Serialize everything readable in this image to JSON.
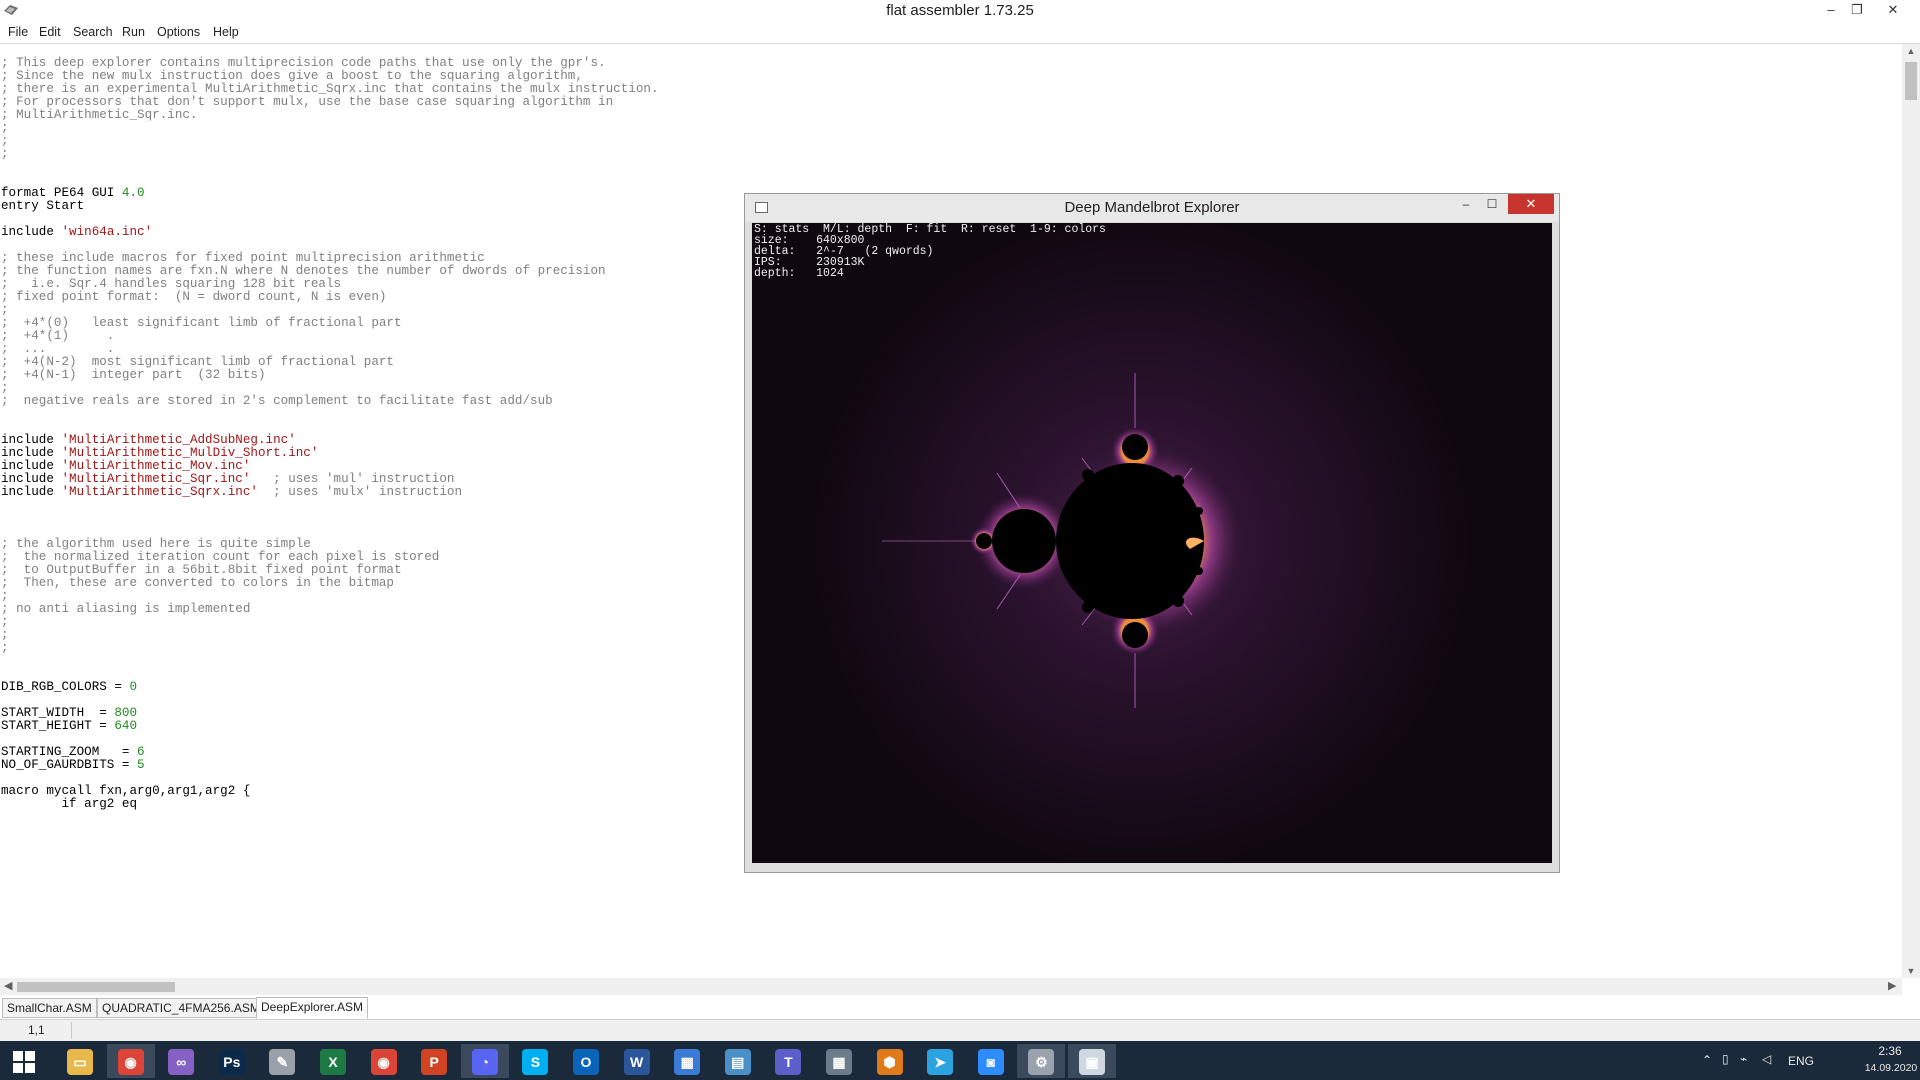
{
  "window": {
    "title": "flat assembler 1.73.25",
    "minimize_glyph": "–",
    "restore_glyph": "❐",
    "close_glyph": "✕"
  },
  "menu": [
    "File",
    "Edit",
    "Search",
    "Run",
    "Options",
    "Help"
  ],
  "code_lines": [
    [
      [
        "c",
        "; This deep explorer contains multiprecision code paths that use only the gpr's."
      ]
    ],
    [
      [
        "c",
        "; Since the new mulx instruction does give a boost to the squaring algorithm,"
      ]
    ],
    [
      [
        "c",
        "; there is an experimental MultiArithmetic_Sqrx.inc that contains the mulx instruction."
      ]
    ],
    [
      [
        "c",
        "; For processors that don't support mulx, use the base case squaring algorithm in"
      ]
    ],
    [
      [
        "c",
        "; MultiArithmetic_Sqr.inc."
      ]
    ],
    [
      [
        "c",
        ";"
      ]
    ],
    [
      [
        "c",
        ";"
      ]
    ],
    [
      [
        "c",
        ";"
      ]
    ],
    [],
    [],
    [
      [
        "p",
        "format PE64 GUI "
      ],
      [
        "n",
        "4.0"
      ]
    ],
    [
      [
        "p",
        "entry Start"
      ]
    ],
    [],
    [
      [
        "p",
        "include "
      ],
      [
        "s",
        "'win64a.inc'"
      ]
    ],
    [],
    [
      [
        "c",
        "; these include macros for fixed point multiprecision arithmetic"
      ]
    ],
    [
      [
        "c",
        "; the function names are fxn.N where N denotes the number of dwords of precision"
      ]
    ],
    [
      [
        "c",
        ";   i.e. Sqr.4 handles squaring 128 bit reals"
      ]
    ],
    [
      [
        "c",
        "; fixed point format:  (N = dword count, N is even)"
      ]
    ],
    [
      [
        "c",
        ";"
      ]
    ],
    [
      [
        "c",
        ";  +4*(0)   least significant limb of fractional part"
      ]
    ],
    [
      [
        "c",
        ";  +4*(1)     ."
      ]
    ],
    [
      [
        "c",
        ";  ...        ."
      ]
    ],
    [
      [
        "c",
        ";  +4(N-2)  most significant limb of fractional part"
      ]
    ],
    [
      [
        "c",
        ";  +4(N-1)  integer part  (32 bits)"
      ]
    ],
    [
      [
        "c",
        ";"
      ]
    ],
    [
      [
        "c",
        ";  negative reals are stored in 2's complement to facilitate fast add/sub"
      ]
    ],
    [],
    [],
    [
      [
        "p",
        "include "
      ],
      [
        "s",
        "'MultiArithmetic_AddSubNeg.inc'"
      ]
    ],
    [
      [
        "p",
        "include "
      ],
      [
        "s",
        "'MultiArithmetic_MulDiv_Short.inc'"
      ]
    ],
    [
      [
        "p",
        "include "
      ],
      [
        "s",
        "'MultiArithmetic_Mov.inc'"
      ]
    ],
    [
      [
        "p",
        "include "
      ],
      [
        "s",
        "'MultiArithmetic_Sqr.inc'"
      ],
      [
        "c",
        "   ; uses 'mul' instruction"
      ]
    ],
    [
      [
        "p",
        "include "
      ],
      [
        "s",
        "'MultiArithmetic_Sqrx.inc'"
      ],
      [
        "c",
        "  ; uses 'mulx' instruction"
      ]
    ],
    [],
    [],
    [],
    [
      [
        "c",
        "; the algorithm used here is quite simple"
      ]
    ],
    [
      [
        "c",
        ";  the normalized iteration count for each pixel is stored"
      ]
    ],
    [
      [
        "c",
        ";  to OutputBuffer in a 56bit.8bit fixed point format"
      ]
    ],
    [
      [
        "c",
        ";  Then, these are converted to colors in the bitmap"
      ]
    ],
    [
      [
        "c",
        ";"
      ]
    ],
    [
      [
        "c",
        "; no anti aliasing is implemented"
      ]
    ],
    [
      [
        "c",
        ";"
      ]
    ],
    [
      [
        "c",
        ";"
      ]
    ],
    [
      [
        "c",
        ";"
      ]
    ],
    [],
    [],
    [
      [
        "p",
        "DIB_RGB_COLORS = "
      ],
      [
        "n",
        "0"
      ]
    ],
    [],
    [
      [
        "p",
        "START_WIDTH  = "
      ],
      [
        "n",
        "800"
      ]
    ],
    [
      [
        "p",
        "START_HEIGHT = "
      ],
      [
        "n",
        "640"
      ]
    ],
    [],
    [
      [
        "p",
        "STARTING_ZOOM   = "
      ],
      [
        "n",
        "6"
      ]
    ],
    [
      [
        "p",
        "NO_OF_GAURDBITS = "
      ],
      [
        "n",
        "5"
      ]
    ],
    [],
    [
      [
        "p",
        "macro mycall fxn,arg0,arg1,arg2 {"
      ]
    ],
    [
      [
        "p",
        "        if arg2 eq"
      ]
    ],
    [
      [
        "p",
        "          "
      ]
    ]
  ],
  "tabs": [
    "SmallChar.ASM",
    "QUADRATIC_4FMA256.ASM",
    "DeepExplorer.ASM"
  ],
  "active_tab": 2,
  "status": {
    "cursor_position": "1,1"
  },
  "explorer": {
    "title": "Deep Mandelbrot Explorer",
    "help_line": "S: stats  M/L: depth  F: fit  R: reset  1-9: colors",
    "size_label": "size:",
    "size_value": "640x800",
    "delta_label": "delta:",
    "delta_value": "2^-7   (2 qwords)",
    "ips_label": "IPS:",
    "ips_value": "230913K",
    "depth_label": "depth:",
    "depth_value": "1024",
    "close_glyph": "✕",
    "minimize_glyph": "–",
    "maximize_glyph": "☐"
  },
  "taskbar": {
    "apps": [
      {
        "name": "file-explorer-icon",
        "color": "#e8b84a",
        "glyph": "▭"
      },
      {
        "name": "chrome-icon",
        "color": "#db4437",
        "glyph": "◉",
        "active": true
      },
      {
        "name": "visual-studio-icon",
        "color": "#8661c5",
        "glyph": "∞"
      },
      {
        "name": "photoshop-icon",
        "color": "#0b2a4a",
        "glyph": "Ps"
      },
      {
        "name": "paint-icon",
        "color": "#9aa0a8",
        "glyph": "✎"
      },
      {
        "name": "excel-icon",
        "color": "#1d7a45",
        "glyph": "X"
      },
      {
        "name": "chrome-2-icon",
        "color": "#db4437",
        "glyph": "◉"
      },
      {
        "name": "powerpoint-icon",
        "color": "#d04423",
        "glyph": "P"
      },
      {
        "name": "discord-icon",
        "color": "#5865f2",
        "glyph": "◔",
        "active": true
      },
      {
        "name": "skype-icon",
        "color": "#00aff0",
        "glyph": "S"
      },
      {
        "name": "outlook-icon",
        "color": "#0a64b8",
        "glyph": "O"
      },
      {
        "name": "word-icon",
        "color": "#2b579a",
        "glyph": "W"
      },
      {
        "name": "network-icon",
        "color": "#3a7bd5",
        "glyph": "▦"
      },
      {
        "name": "control-panel-icon",
        "color": "#4a90c8",
        "glyph": "▤"
      },
      {
        "name": "teams-icon",
        "color": "#5b5fc7",
        "glyph": "T"
      },
      {
        "name": "calculator-icon",
        "color": "#6b7b8b",
        "glyph": "▦"
      },
      {
        "name": "share-icon",
        "color": "#e07a1a",
        "glyph": "⬢"
      },
      {
        "name": "telegram-icon",
        "color": "#2aa3df",
        "glyph": "➤"
      },
      {
        "name": "zoom-icon",
        "color": "#2d8cff",
        "glyph": "◙"
      },
      {
        "name": "flat-assembler-icon",
        "color": "#9aa3ad",
        "glyph": "⚙",
        "active": true
      },
      {
        "name": "mandelbrot-window-icon",
        "color": "#cfd8e0",
        "glyph": "▣",
        "active": true
      }
    ],
    "language": "ENG",
    "time": "2:36",
    "date": "14.09.2020"
  }
}
